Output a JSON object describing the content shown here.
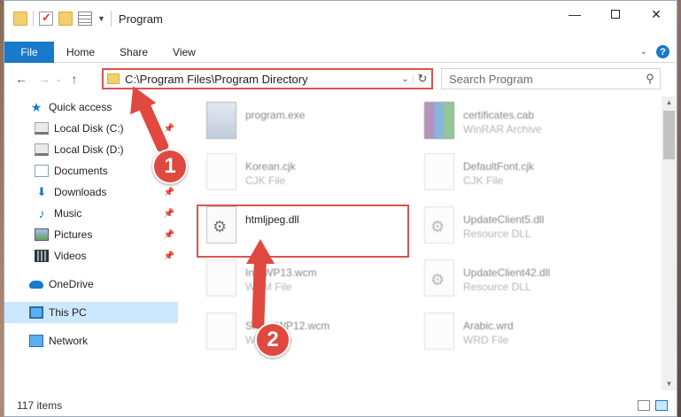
{
  "window": {
    "title": "Program"
  },
  "ribbon": {
    "tabs": [
      "File",
      "Home",
      "Share",
      "View"
    ]
  },
  "nav": {
    "address": "C:\\Program Files\\Program Directory",
    "search_placeholder": "Search Program"
  },
  "sidebar": {
    "items": [
      {
        "label": "Quick access"
      },
      {
        "label": "Local Disk (C:)"
      },
      {
        "label": "Local Disk (D:)"
      },
      {
        "label": "Documents"
      },
      {
        "label": "Downloads"
      },
      {
        "label": "Music"
      },
      {
        "label": "Pictures"
      },
      {
        "label": "Videos"
      },
      {
        "label": "OneDrive"
      },
      {
        "label": "This PC"
      },
      {
        "label": "Network"
      }
    ]
  },
  "files": [
    {
      "name": "program.exe",
      "type": ""
    },
    {
      "name": "certificates.cab",
      "type": "WinRAR Archive"
    },
    {
      "name": "Korean.cjk",
      "type": "CJK File"
    },
    {
      "name": "DefaultFont.cjk",
      "type": "CJK File"
    },
    {
      "name": "htmljpeg.dll",
      "type": ""
    },
    {
      "name": "UpdateClient5.dll",
      "type": "Resource DLL"
    },
    {
      "name": "InfoWP13.wcm",
      "type": "WCM File"
    },
    {
      "name": "UpdateClient42.dll",
      "type": "Resource DLL"
    },
    {
      "name": "SnoopWP12.wcm",
      "type": "WCM File"
    },
    {
      "name": "Arabic.wrd",
      "type": "WRD File"
    }
  ],
  "status": {
    "item_count": "117 items"
  },
  "annotations": {
    "step1": "1",
    "step2": "2"
  },
  "colors": {
    "accent": "#1979ca",
    "annotation": "#e0493f"
  }
}
